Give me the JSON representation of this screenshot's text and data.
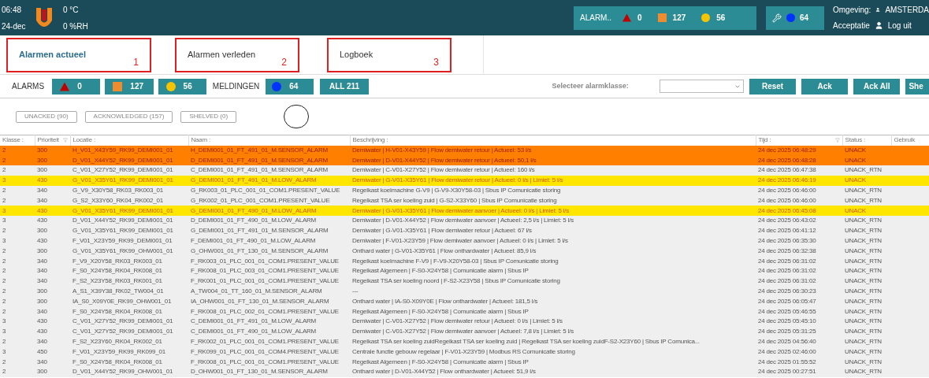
{
  "header": {
    "time": "06:48",
    "date": "24-dec",
    "temperature": "0 °C",
    "humidity": "0 %RH",
    "alarm_panel": {
      "label": "ALARM..",
      "red": "0",
      "orange": "127",
      "yellow": "56"
    },
    "service_panel": {
      "blue": "64"
    },
    "environment_label": "Omgeving:",
    "environment_value": "AMSTERDA",
    "mode": "Acceptatie",
    "logout": "Log uit"
  },
  "tabs": [
    {
      "label": "Alarmen actueel",
      "selected": true,
      "annotation": "1"
    },
    {
      "label": "Alarmen verleden",
      "selected": false,
      "annotation": "2"
    },
    {
      "label": "Logboek",
      "selected": false,
      "annotation": "3"
    }
  ],
  "toolbar": {
    "alarms_label": "ALARMS",
    "alarm_buttons": [
      {
        "kind": "triangle",
        "count": "0"
      },
      {
        "kind": "square",
        "count": "127"
      },
      {
        "kind": "circle",
        "count": "56"
      }
    ],
    "meldingen_label": "MELDINGEN",
    "melding_button": "64",
    "all_button": "ALL 211",
    "class_label": "Selecteer alarmklasse:",
    "actions": [
      "Reset",
      "Ack",
      "Ack All",
      "She"
    ]
  },
  "filters": [
    "UNACKED (90)",
    "ACKNOWLEDGED (157)",
    "SHELVED (0)"
  ],
  "table": {
    "columns": [
      {
        "label": "Klasse :",
        "filter": false
      },
      {
        "label": "Prioriteit",
        "filter": true
      },
      {
        "label": "Locatie :",
        "filter": false
      },
      {
        "label": "Naam :",
        "filter": false
      },
      {
        "label": "Beschrijving :",
        "filter": false
      },
      {
        "label": "Tijd :",
        "filter": true
      },
      {
        "label": "Status :",
        "filter": false
      },
      {
        "label": "Gebruik",
        "filter": false
      }
    ],
    "rows": [
      {
        "kind": "alarm",
        "color": "#ff8000",
        "cells": [
          "2",
          "300",
          "H_V01_X43Y59_RK99_DEMI001_01",
          "H_DEMI001_01_FT_491_01_M.SENSOR_ALARM",
          "Demiwater | H-V01-X43Y59 | Flow demiwater retour  | Actueel: 53 l/s",
          "24 dec 2025 06:48:29",
          "UNACK"
        ]
      },
      {
        "kind": "alarm",
        "color": "#ff8000",
        "cells": [
          "2",
          "300",
          "D_V01_X44Y52_RK99_DEMI001_01",
          "D_DEMI001_01_FT_491_01_M.SENSOR_ALARM",
          "Demiwater | D-V01-X44Y52 | Flow demiwater retour  | Actueel: 50,1 l/s",
          "24 dec 2025 06:48:28",
          "UNACK"
        ]
      },
      {
        "kind": "normal",
        "color": "#efefef",
        "cells": [
          "2",
          "300",
          "C_V01_X27Y52_RK99_DEMI001_01",
          "C_DEMI001_01_FT_491_01_M.SENSOR_ALARM",
          "Demiwater | C-V01-X27Y52 | Flow demiwater retour  | Actueel: 160 l/s",
          "24 dec 2025 06:47:38",
          "UNACK_RTN"
        ]
      },
      {
        "kind": "warning",
        "color": "#ffe600",
        "cells": [
          "3",
          "430",
          "G_V01_X35Y61_RK99_DEMI001_01",
          "G_DEMI001_01_FT_491_01_M.LOW_ALARM",
          "Demiwater | G-V01-X35Y61 | Flow demiwater retour  | Actueel: 0 l/s | Limiet: 5 l/s",
          "24 dec 2025 06:46:19",
          "UNACK"
        ]
      },
      {
        "kind": "normal",
        "color": "#efefef",
        "cells": [
          "2",
          "340",
          "G_V9_X30Y58_RK03_RK003_01",
          "G_RK003_01_PLC_001_01_COM1.PRESENT_VALUE",
          "Regelkast koelmachine G-V9 | G-V9-X30Y58-03 | Sbus IP Comunicatie storing",
          "24 dec 2025 06:46:00",
          "UNACK_RTN"
        ]
      },
      {
        "kind": "normal",
        "color": "#efefef",
        "cells": [
          "2",
          "340",
          "G_S2_X33Y60_RK04_RK002_01",
          "G_RK002_01_PLC_001_COM1.PRESENT_VALUE",
          "Regelkast TSA ser koeling zuid | G-S2-X33Y60 | Sbus IP Comunicatie storing",
          "24 dec 2025 06:46:00",
          "UNACK_RTN"
        ]
      },
      {
        "kind": "warning",
        "color": "#ffe600",
        "cells": [
          "3",
          "430",
          "G_V01_X35Y61_RK99_DEMI001_01",
          "G_DEMI001_01_FT_490_01_M.LOW_ALARM",
          "Demiwater | G-V01-X35Y61 | Flow demiwater aanvoer  | Actueel: 0 l/s | Limiet: 5 l/s",
          "24 dec 2025 06:45:08",
          "UNACK"
        ]
      },
      {
        "kind": "normal",
        "color": "#efefef",
        "cells": [
          "3",
          "430",
          "D_V01_X44Y52_RK99_DEMI001_01",
          "D_DEMI001_01_FT_490_01_M.LOW_ALARM",
          "Demiwater | D-V01-X44Y52 | Flow demiwater aanvoer  | Actueel: 2,5 l/s | Limiet: 5 l/s",
          "24 dec 2025 06:43:02",
          "UNACK_RTN"
        ]
      },
      {
        "kind": "normal",
        "color": "#efefef",
        "cells": [
          "2",
          "300",
          "G_V01_X35Y61_RK99_DEMI001_01",
          "G_DEMI001_01_FT_491_01_M.SENSOR_ALARM",
          "Demiwater | G-V01-X35Y61 | Flow demiwater retour  | Actueel: 67 l/s",
          "24 dec 2025 06:41:12",
          "UNACK_RTN"
        ]
      },
      {
        "kind": "normal",
        "color": "#efefef",
        "cells": [
          "3",
          "430",
          "F_V01_X23Y59_RK99_DEMI001_01",
          "F_DEMI001_01_FT_490_01_M.LOW_ALARM",
          "Demiwater | F-V01-X23Y59 | Flow demiwater aanvoer  | Actueel: 0 l/s | Limiet: 5 l/s",
          "24 dec 2025 06:35:30",
          "UNACK_RTN"
        ]
      },
      {
        "kind": "normal",
        "color": "#efefef",
        "cells": [
          "2",
          "300",
          "G_V01_X35Y61_RK99_OHW001_01",
          "G_OHW001_01_FT_130_01_M.SENSOR_ALARM",
          "Onthard water | G-V01-X35Y61 | Flow onthardwater  | Actueel: 85,9 l/s",
          "24 dec 2025 06:32:38",
          "UNACK_RTN"
        ]
      },
      {
        "kind": "normal",
        "color": "#efefef",
        "cells": [
          "2",
          "340",
          "F_V9_X20Y58_RK03_RK003_01",
          "F_RK003_01_PLC_001_01_COM1.PRESENT_VALUE",
          "Regelkast koelmachine F-V9 | F-V9-X20Y58-03 | Sbus IP Comunicatie storing",
          "24 dec 2025 06:31:02",
          "UNACK_RTN"
        ]
      },
      {
        "kind": "normal",
        "color": "#efefef",
        "cells": [
          "2",
          "340",
          "F_S0_X24Y58_RK04_RK008_01",
          "F_RK008_01_PLC_003_01_COM1.PRESENT_VALUE",
          "Regelkast Algemeen | F-S0-X24Y58 | Comunicatie alarm | Sbus IP",
          "24 dec 2025 06:31:02",
          "UNACK_RTN"
        ]
      },
      {
        "kind": "normal",
        "color": "#efefef",
        "cells": [
          "2",
          "340",
          "F_S2_X23Y58_RK03_RK001_01",
          "F_RK001_01_PLC_001_01_COM1.PRESENT_VALUE",
          "Regelkast TSA ser koeling noord | F-S2-X23Y58 | Sbus IP Comunicatie storing",
          "24 dec 2025 06:31:02",
          "UNACK_RTN"
        ]
      },
      {
        "kind": "normal",
        "color": "#efefef",
        "cells": [
          "2",
          "300",
          "A_S1_X39Y38_RK02_TW004_01",
          "A_TW004_01_TT_160_01_M.SENSOR_ALARM",
          "---",
          "24 dec 2025 06:30:23",
          "UNACK_RTN"
        ]
      },
      {
        "kind": "normal",
        "color": "#efefef",
        "cells": [
          "2",
          "300",
          "IA_S0_X09Y0E_RK99_OHW001_01",
          "IA_OHW001_01_FT_130_01_M.SENSOR_ALARM",
          "Onthard water | IA-S0-X09Y0E | Flow onthardwater  | Actueel: 181,5 l/s",
          "24 dec 2025 06:05:47",
          "UNACK_RTN"
        ]
      },
      {
        "kind": "normal",
        "color": "#efefef",
        "cells": [
          "2",
          "340",
          "F_S0_X24Y58_RK04_RK008_01",
          "F_RK008_01_PLC_002_01_COM1.PRESENT_VALUE",
          "Regelkast Algemeen | F-S0-X24Y58 | Comunicatie alarm | Sbus IP",
          "24 dec 2025 05:46:55",
          "UNACK_RTN"
        ]
      },
      {
        "kind": "normal",
        "color": "#efefef",
        "cells": [
          "3",
          "430",
          "C_V01_X27Y52_RK99_DEMI001_01",
          "C_DEMI001_01_FT_491_01_M.LOW_ALARM",
          "Demiwater | C-V01-X27Y52 | Flow demiwater retour  | Actueel: 0 l/s | Limiet: 5 l/s",
          "24 dec 2025 05:45:10",
          "UNACK_RTN"
        ]
      },
      {
        "kind": "normal",
        "color": "#efefef",
        "cells": [
          "3",
          "430",
          "C_V01_X27Y52_RK99_DEMI001_01",
          "C_DEMI001_01_FT_490_01_M.LOW_ALARM",
          "Demiwater | C-V01-X27Y52 | Flow demiwater aanvoer  | Actueel: 7,8 l/s | Limiet: 5 l/s",
          "24 dec 2025 05:31:25",
          "UNACK_RTN"
        ]
      },
      {
        "kind": "normal",
        "color": "#efefef",
        "cells": [
          "2",
          "340",
          "F_S2_X23Y60_RK04_RK002_01",
          "F_RK002_01_PLC_001_01_COM1.PRESENT_VALUE",
          "Regelkast TSA ser koeling zuidRegelkast TSA ser koeling zuid | Regelkast TSA ser koeling zuidF-S2-X23Y60 | Sbus IP Comunica...",
          "24 dec 2025 04:56:40",
          "UNACK_RTN"
        ]
      },
      {
        "kind": "normal",
        "color": "#efefef",
        "cells": [
          "3",
          "450",
          "F_V01_X23Y59_RK99_RK099_01",
          "F_RK099_01_PLC_001_01_COM4.PRESENT_VALUE",
          "Centrale functie gebouw regelaar | F-V01-X23Y59 | Modbus RS Comunicatie storing",
          "24 dec 2025 02:46:00",
          "UNACK_RTN"
        ]
      },
      {
        "kind": "normal",
        "color": "#efefef",
        "cells": [
          "2",
          "340",
          "F_S0_X24Y58_RK04_RK008_01",
          "F_RK008_01_PLC_001_01_COM1.PRESENT_VALUE",
          "Regelkast Algemeen | F-S0-X24Y58 | Comunicatie alarm | Sbus IP",
          "24 dec 2025 01:55:52",
          "UNACK_RTN"
        ]
      },
      {
        "kind": "normal",
        "color": "#efefef",
        "cells": [
          "2",
          "300",
          "D_V01_X44Y52_RK99_OHW001_01",
          "D_OHW001_01_FT_130_01_M.SENSOR_ALARM",
          "Onthard water | D-V01-X44Y52 | Flow onthardwater  | Actueel: 51,9 l/s",
          "24 dec 2025 00:27:51",
          "UNACK_RTN"
        ]
      }
    ]
  }
}
